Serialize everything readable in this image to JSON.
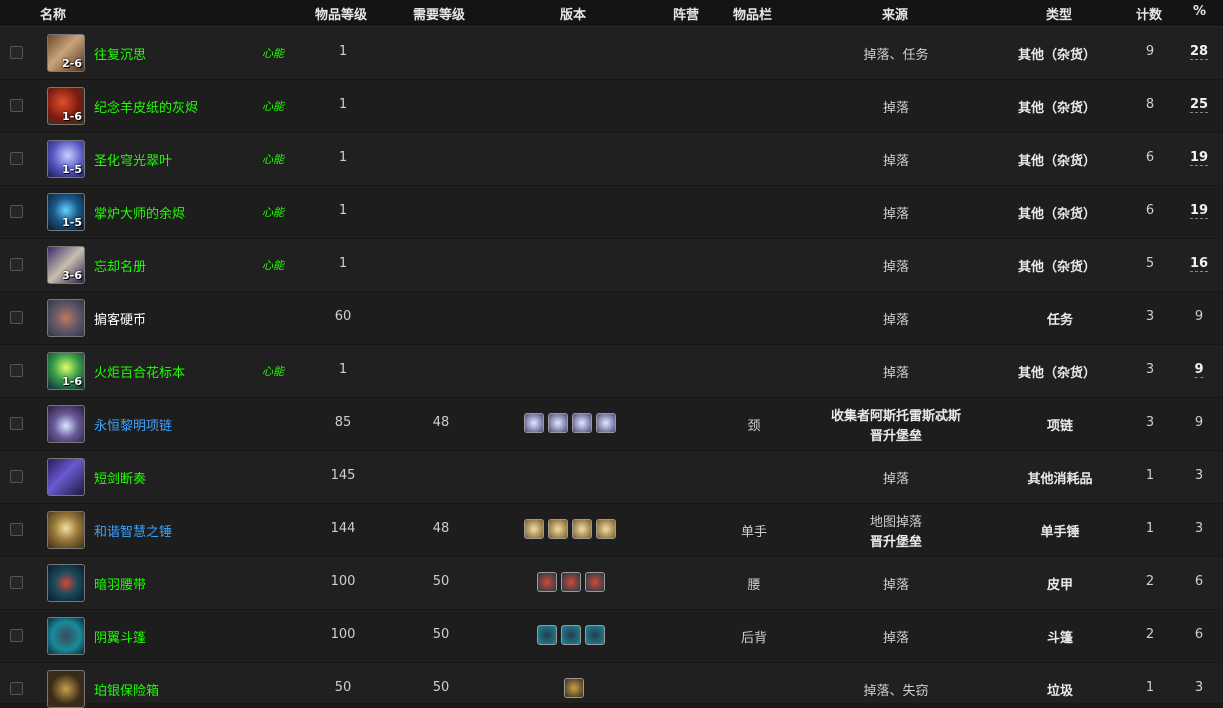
{
  "headers": {
    "name": "名称",
    "item_level": "物品等级",
    "req_level": "需要等级",
    "version": "版本",
    "faction": "阵营",
    "slot": "物品栏",
    "source": "来源",
    "type": "类型",
    "count": "计数",
    "percent": "%"
  },
  "rows": [
    {
      "icon": "scroll-icon",
      "icon_count": "2-6",
      "name": "往复沉思",
      "tag": "心能",
      "ilvl": "1",
      "req": "",
      "slot": "",
      "source": "掉落、任务",
      "source2": "",
      "type": "其他（杂货）",
      "count": "9",
      "pct": "28"
    },
    {
      "icon": "ember-scroll-icon",
      "icon_count": "1-6",
      "name": "纪念羊皮纸的灰烬",
      "tag": "心能",
      "ilvl": "1",
      "req": "",
      "slot": "",
      "source": "掉落",
      "source2": "",
      "type": "其他（杂货）",
      "count": "8",
      "pct": "25"
    },
    {
      "icon": "leaf-icon",
      "icon_count": "1-5",
      "name": "圣化穹光翠叶",
      "tag": "心能",
      "ilvl": "1",
      "req": "",
      "slot": "",
      "source": "掉落",
      "source2": "",
      "type": "其他（杂货）",
      "count": "6",
      "pct": "19"
    },
    {
      "icon": "ember-icon",
      "icon_count": "1-5",
      "name": "掌炉大师的余烬",
      "tag": "心能",
      "ilvl": "1",
      "req": "",
      "slot": "",
      "source": "掉落",
      "source2": "",
      "type": "其他（杂货）",
      "count": "6",
      "pct": "19"
    },
    {
      "icon": "register-icon",
      "icon_count": "3-6",
      "name": "忘却名册",
      "tag": "心能",
      "ilvl": "1",
      "req": "",
      "slot": "",
      "source": "掉落",
      "source2": "",
      "type": "其他（杂货）",
      "count": "5",
      "pct": "16"
    },
    {
      "icon": "coin-icon",
      "icon_count": "",
      "name": "掮客硬币",
      "tag": "",
      "ilvl": "60",
      "req": "",
      "slot": "",
      "source": "掉落",
      "source2": "",
      "type": "任务",
      "count": "3",
      "pct": "9"
    },
    {
      "icon": "lily-icon",
      "icon_count": "1-6",
      "name": "火炬百合花标本",
      "tag": "心能",
      "ilvl": "1",
      "req": "",
      "slot": "",
      "source": "掉落",
      "source2": "",
      "type": "其他（杂货）",
      "count": "3",
      "pct": "9"
    },
    {
      "icon": "necklace-icon",
      "icon_count": "",
      "name": "永恒黎明项链",
      "tag": "",
      "ilvl": "85",
      "req": "48",
      "slot": "颈",
      "source": "收集者阿斯托雷斯忒斯",
      "source2": "晋升堡垒",
      "type": "项链",
      "count": "3",
      "pct": "9"
    },
    {
      "icon": "dagger-icon",
      "icon_count": "",
      "name": "短剑断奏",
      "tag": "",
      "ilvl": "145",
      "req": "",
      "slot": "",
      "source": "掉落",
      "source2": "",
      "type": "其他消耗品",
      "count": "1",
      "pct": "3"
    },
    {
      "icon": "mace-icon",
      "icon_count": "",
      "name": "和谐智慧之锤",
      "tag": "",
      "ilvl": "144",
      "req": "48",
      "slot": "单手",
      "source": "地图掉落",
      "source2": "晋升堡垒",
      "type": "单手锤",
      "count": "1",
      "pct": "3"
    },
    {
      "icon": "belt-icon",
      "icon_count": "",
      "name": "暗羽腰带",
      "tag": "",
      "ilvl": "100",
      "req": "50",
      "slot": "腰",
      "source": "掉落",
      "source2": "",
      "type": "皮甲",
      "count": "2",
      "pct": "6"
    },
    {
      "icon": "cloak-icon",
      "icon_count": "",
      "name": "阴翼斗篷",
      "tag": "",
      "ilvl": "100",
      "req": "50",
      "slot": "后背",
      "source": "掉落",
      "source2": "",
      "type": "斗篷",
      "count": "2",
      "pct": "6"
    },
    {
      "icon": "chest-icon",
      "icon_count": "",
      "name": "珀银保险箱",
      "tag": "",
      "ilvl": "50",
      "req": "50",
      "slot": "",
      "source": "掉落、失窃",
      "source2": "",
      "type": "垃圾",
      "count": "1",
      "pct": "3"
    }
  ],
  "colors": {
    "uncommon": "#1eff00",
    "rare": "#3ea3ff",
    "common": "#ffffff"
  }
}
